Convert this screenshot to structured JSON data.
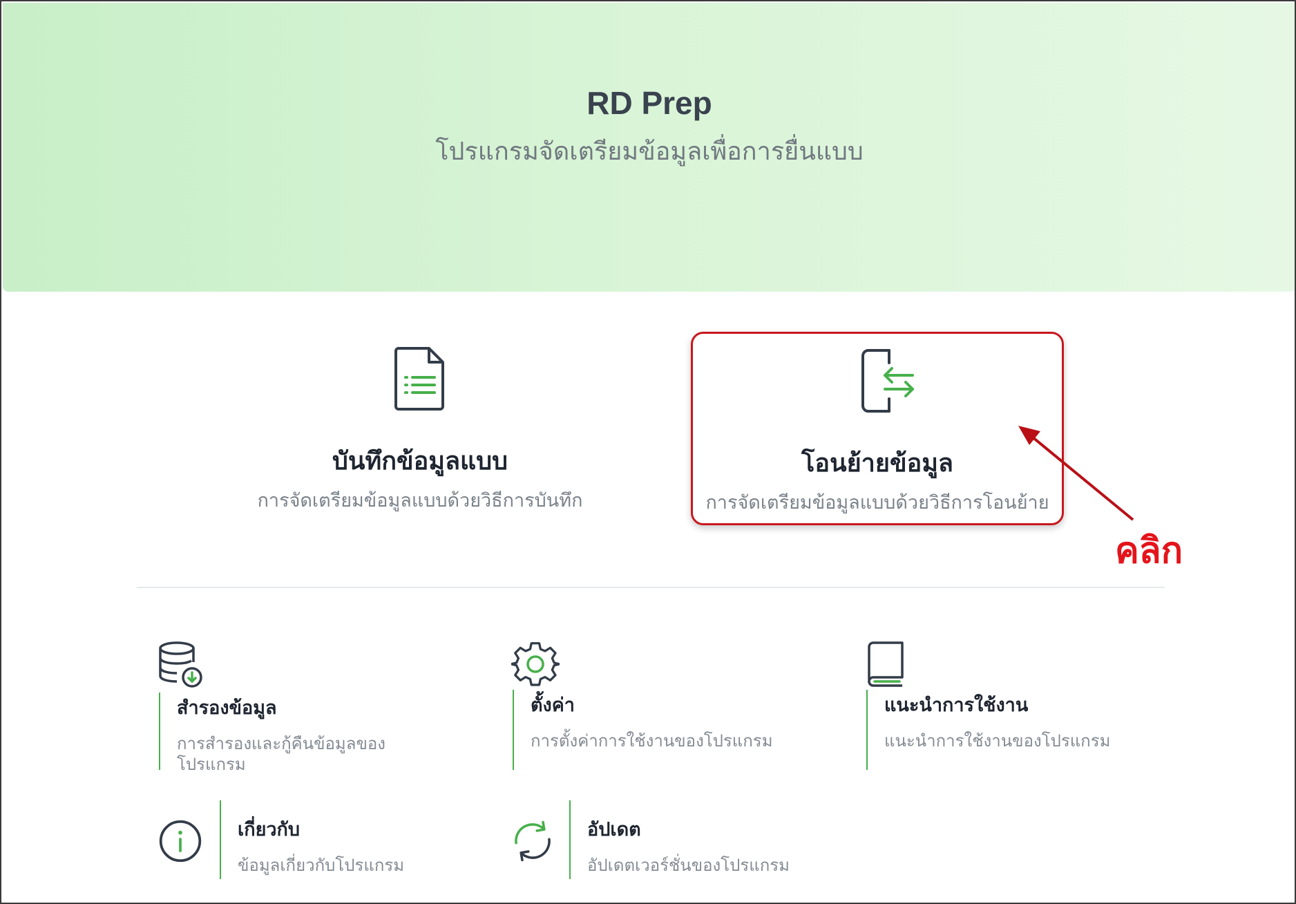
{
  "header": {
    "title": "RD Prep",
    "subtitle": "โปรแกรมจัดเตรียมข้อมูลเพื่อการยื่นแบบ"
  },
  "main_actions": [
    {
      "title": "บันทึกข้อมูลแบบ",
      "description": "การจัดเตรียมข้อมูลแบบด้วยวิธีการบันทึก",
      "icon": "document-list-icon"
    },
    {
      "title": "โอนย้ายข้อมูล",
      "description": "การจัดเตรียมข้อมูลแบบด้วยวิธีการโอนย้าย",
      "icon": "transfer-icon"
    }
  ],
  "tools": [
    {
      "title": "สำรองข้อมูล",
      "description": "การสำรองและกู้คืนข้อมูลของโปรแกรม",
      "icon": "database-download-icon"
    },
    {
      "title": "ตั้งค่า",
      "description": "การตั้งค่าการใช้งานของโปรแกรม",
      "icon": "gear-icon"
    },
    {
      "title": "แนะนำการใช้งาน",
      "description": "แนะนำการใช้งานของโปรแกรม",
      "icon": "book-icon"
    },
    {
      "title": "เกี่ยวกับ",
      "description": "ข้อมูลเกี่ยวกับโปรแกรม",
      "icon": "info-icon"
    },
    {
      "title": "อัปเดต",
      "description": "อัปเดตเวอร์ชั่นของโปรแกรม",
      "icon": "refresh-icon"
    }
  ],
  "annotation": {
    "label": "คลิก",
    "color": "#e4141b"
  },
  "colors": {
    "accent_green": "#47b04b",
    "icon_dark": "#333c48",
    "highlight_red": "#c8171e"
  }
}
